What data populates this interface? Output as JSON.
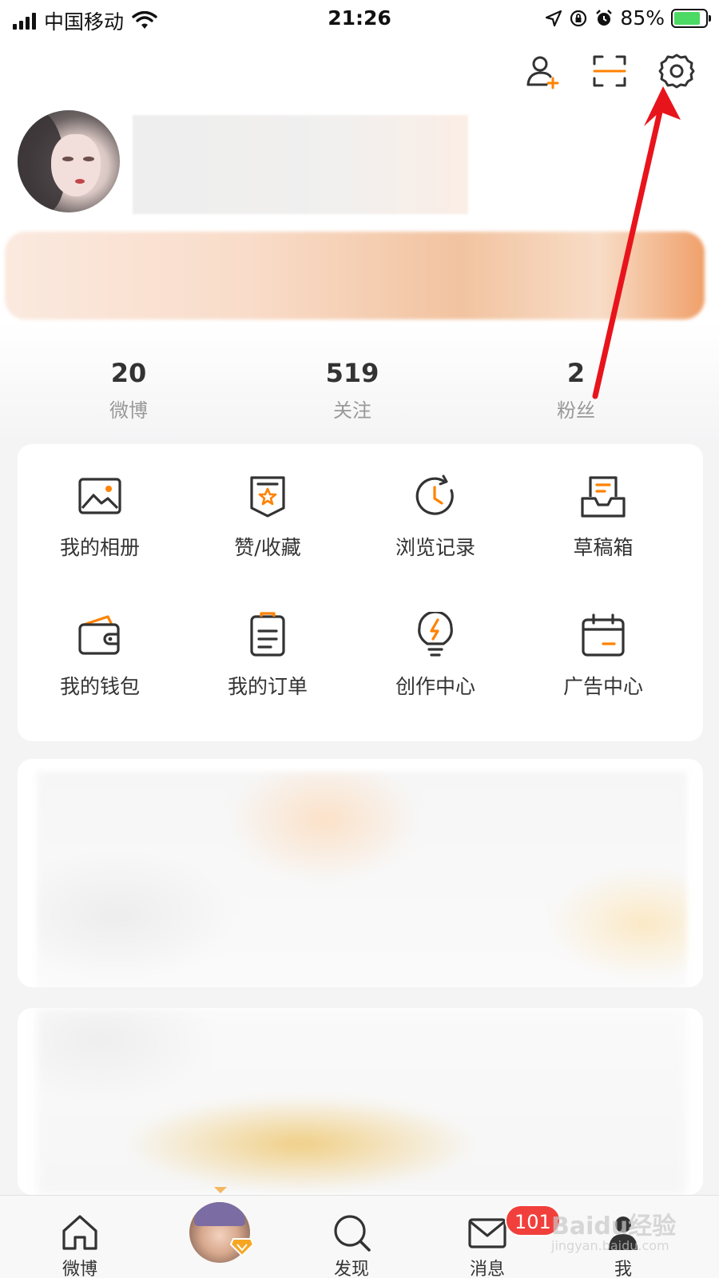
{
  "status_bar": {
    "carrier": "中国移动",
    "time": "21:26",
    "battery_percent": "85%",
    "battery_level": 0.85
  },
  "header": {
    "icons": [
      "add-friend-icon",
      "scan-icon",
      "settings-icon"
    ]
  },
  "stats": [
    {
      "count": "20",
      "label": "微博"
    },
    {
      "count": "519",
      "label": "关注"
    },
    {
      "count": "2",
      "label": "粉丝"
    }
  ],
  "menu": [
    {
      "label": "我的相册",
      "icon": "photo-album-icon"
    },
    {
      "label": "赞/收藏",
      "icon": "like-favorite-icon"
    },
    {
      "label": "浏览记录",
      "icon": "history-icon"
    },
    {
      "label": "草稿箱",
      "icon": "drafts-icon"
    },
    {
      "label": "我的钱包",
      "icon": "wallet-icon"
    },
    {
      "label": "我的订单",
      "icon": "orders-icon"
    },
    {
      "label": "创作中心",
      "icon": "creator-center-icon"
    },
    {
      "label": "广告中心",
      "icon": "ad-center-icon"
    }
  ],
  "tabbar": {
    "items": [
      {
        "label": "微博",
        "icon": "home-icon"
      },
      {
        "label": "",
        "icon": "avatar"
      },
      {
        "label": "发现",
        "icon": "search-icon"
      },
      {
        "label": "消息",
        "icon": "mail-icon"
      },
      {
        "label": "我",
        "icon": "profile-icon"
      }
    ],
    "message_badge": "101"
  },
  "watermark": {
    "text": "Baidu经验",
    "sub": "jingyan.baidu.com"
  },
  "colors": {
    "accent": "#ff8200",
    "annotation_arrow": "#e8141c",
    "badge": "#f1403c"
  }
}
